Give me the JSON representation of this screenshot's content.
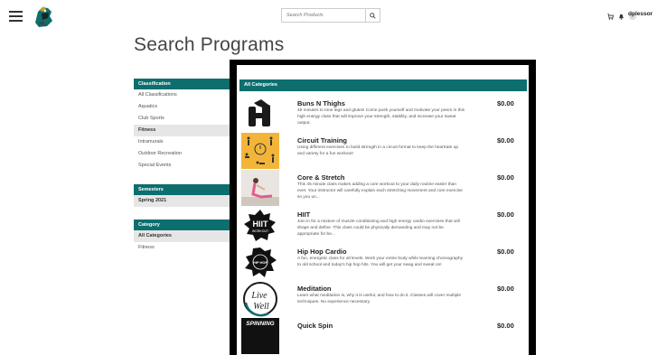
{
  "header": {
    "search_placeholder": "Search Products",
    "username": "dplessor"
  },
  "page": {
    "title": "Search Programs"
  },
  "sidebar": {
    "classification": {
      "header": "Classification",
      "items": [
        {
          "label": "All Classifications",
          "active": false
        },
        {
          "label": "Aquatics",
          "active": false
        },
        {
          "label": "Club Sports",
          "active": false
        },
        {
          "label": "Fitness",
          "active": true
        },
        {
          "label": "Intramurals",
          "active": false
        },
        {
          "label": "Outdoor Recreation",
          "active": false
        },
        {
          "label": "Special Events",
          "active": false
        }
      ]
    },
    "semesters": {
      "header": "Semesters",
      "items": [
        {
          "label": "Spring 2021",
          "active": true
        }
      ]
    },
    "category": {
      "header": "Category",
      "items": [
        {
          "label": "All Categories",
          "active": true
        },
        {
          "label": "Fitness",
          "active": false
        }
      ]
    }
  },
  "main": {
    "category_header": "All Categories",
    "programs": [
      {
        "name": "Buns N Thighs",
        "price": "$0.00",
        "thumb": "dumbbells",
        "description": "45 minutes to tone legs and glutes! Come push yourself and motivate your peers in this high energy class that will improve your strength, stability, and increase your sweat output."
      },
      {
        "name": "Circuit Training",
        "price": "$0.00",
        "thumb": "circuit-illustration",
        "description": "Using different exercises to build strength in a circuit format to keep the heartrate up and variety for a fun workout!"
      },
      {
        "name": "Core & Stretch",
        "price": "$0.00",
        "thumb": "stretch-photo",
        "description": "This 45 minute class makes adding a core workout to your daily routine easier than ever. Your instructor will carefully explain each stretching movement and core exercise so you un..."
      },
      {
        "name": "HIIT",
        "price": "$0.00",
        "thumb": "hiit-logo",
        "description": "Join in for a mixture of muscle conditioning and high energy cardio exercises that will shape and define. This class could be physically demanding and may not be appropriate for be..."
      },
      {
        "name": "Hip Hop Cardio",
        "price": "$0.00",
        "thumb": "hip-hop-logo",
        "description": "A fun, energetic class for all levels. Work your entire body while learning choreography to old school and today's hip hop hits. You will get your swag and sweat on!"
      },
      {
        "name": "Meditation",
        "price": "$0.00",
        "thumb": "live-well-logo",
        "description": "Learn what meditation is, why it is useful, and how to do it. Classes will cover multiple techniques. No experience necessary."
      },
      {
        "name": "Quick Spin",
        "price": "$0.00",
        "thumb": "spinning-logo",
        "description": ""
      }
    ]
  },
  "thumb_text": {
    "hiit": "HIIT",
    "hiit_sub": "WORKOUT",
    "hip_hop": "HIP HOP",
    "live": "Live",
    "well": "Well",
    "spinning": "SPINNING"
  },
  "colors": {
    "accent": "#0d6e6e",
    "frame": "#000000"
  }
}
